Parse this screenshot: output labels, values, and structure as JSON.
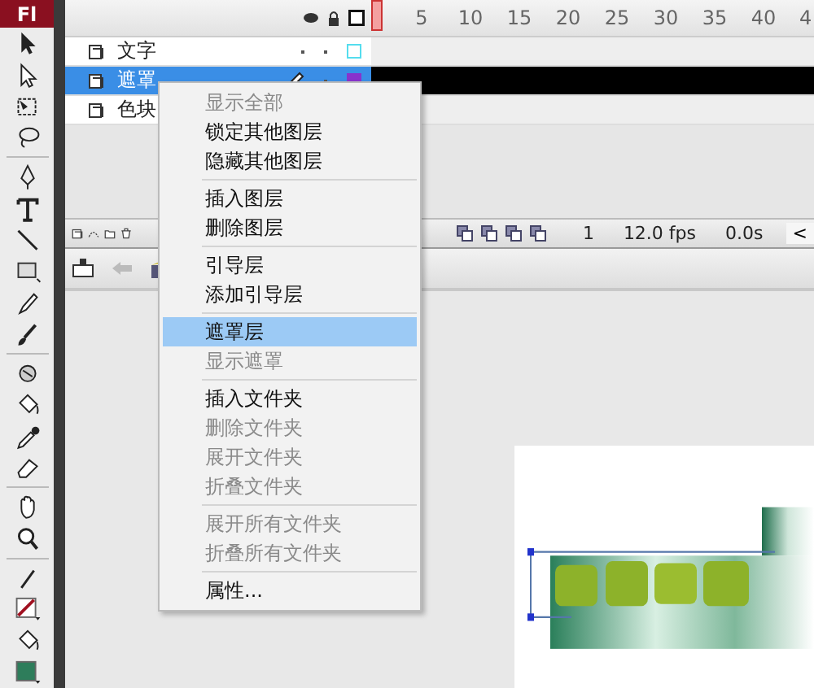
{
  "app_logo": "Fl",
  "timeline": {
    "ruler": [
      "5",
      "10",
      "15",
      "20",
      "25",
      "30",
      "35",
      "40",
      "4"
    ],
    "layers": [
      {
        "name": "文字",
        "selected": false,
        "editing": false,
        "color": "#55ddee"
      },
      {
        "name": "遮罩",
        "selected": true,
        "editing": true,
        "color": "#8833cc"
      },
      {
        "name": "色块",
        "selected": false,
        "editing": false
      }
    ],
    "status": {
      "frame": "1",
      "fps": "12.0 fps",
      "time": "0.0s",
      "scroll_arrow": "<"
    }
  },
  "context_menu": {
    "items": [
      {
        "kind": "item",
        "label": "显示全部",
        "disabled": true,
        "selected": false
      },
      {
        "kind": "item",
        "label": "锁定其他图层",
        "disabled": false,
        "selected": false
      },
      {
        "kind": "item",
        "label": "隐藏其他图层",
        "disabled": false,
        "selected": false
      },
      {
        "kind": "separator"
      },
      {
        "kind": "item",
        "label": "插入图层",
        "disabled": false,
        "selected": false
      },
      {
        "kind": "item",
        "label": "删除图层",
        "disabled": false,
        "selected": false
      },
      {
        "kind": "separator"
      },
      {
        "kind": "item",
        "label": "引导层",
        "disabled": false,
        "selected": false
      },
      {
        "kind": "item",
        "label": "添加引导层",
        "disabled": false,
        "selected": false
      },
      {
        "kind": "separator"
      },
      {
        "kind": "item",
        "label": "遮罩层",
        "disabled": false,
        "selected": true
      },
      {
        "kind": "item",
        "label": "显示遮罩",
        "disabled": true,
        "selected": false
      },
      {
        "kind": "separator"
      },
      {
        "kind": "item",
        "label": "插入文件夹",
        "disabled": false,
        "selected": false
      },
      {
        "kind": "item",
        "label": "删除文件夹",
        "disabled": true,
        "selected": false
      },
      {
        "kind": "item",
        "label": "展开文件夹",
        "disabled": true,
        "selected": false
      },
      {
        "kind": "item",
        "label": "折叠文件夹",
        "disabled": true,
        "selected": false
      },
      {
        "kind": "separator"
      },
      {
        "kind": "item",
        "label": "展开所有文件夹",
        "disabled": true,
        "selected": false
      },
      {
        "kind": "item",
        "label": "折叠所有文件夹",
        "disabled": true,
        "selected": false
      },
      {
        "kind": "separator"
      },
      {
        "kind": "item",
        "label": "属性...",
        "disabled": false,
        "selected": false
      }
    ]
  }
}
